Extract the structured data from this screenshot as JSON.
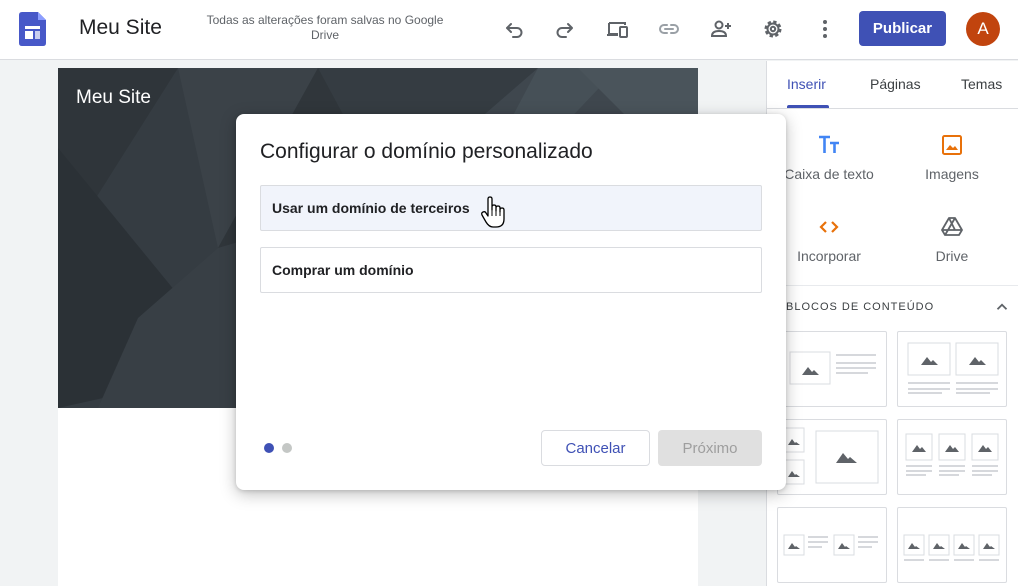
{
  "header": {
    "site_title": "Meu Site",
    "save_status": "Todas as alterações foram salvas no Google Drive",
    "publish_label": "Publicar",
    "avatar_letter": "A",
    "icons": [
      "undo-icon",
      "redo-icon",
      "preview-devices-icon",
      "link-icon",
      "share-icon",
      "settings-icon",
      "more-vert-icon"
    ]
  },
  "page": {
    "hero_title": "Meu Site"
  },
  "panel": {
    "tabs": [
      {
        "label": "Inserir",
        "active": true
      },
      {
        "label": "Páginas",
        "active": false
      },
      {
        "label": "Temas",
        "active": false
      }
    ],
    "tools": [
      {
        "label": "Caixa de texto",
        "icon": "text-box-icon"
      },
      {
        "label": "Imagens",
        "icon": "image-icon"
      },
      {
        "label": "Incorporar",
        "icon": "embed-icon"
      },
      {
        "label": "Drive",
        "icon": "drive-icon"
      }
    ],
    "section_title": "BLOCOS DE CONTEÚDO"
  },
  "dialog": {
    "title": "Configurar o domínio personalizado",
    "options": [
      {
        "label": "Usar um domínio de terceiros",
        "hovered": true
      },
      {
        "label": "Comprar um domínio",
        "hovered": false
      }
    ],
    "step": {
      "current": 1,
      "total": 2
    },
    "cancel_label": "Cancelar",
    "next_label": "Próximo",
    "next_enabled": false
  },
  "colors": {
    "accent": "#3f51b5",
    "hero_bg": "#353c42",
    "avatar_bg": "#c1440e",
    "tool_icon_blue": "#4285f4",
    "tool_icon_orange": "#e8710a"
  }
}
